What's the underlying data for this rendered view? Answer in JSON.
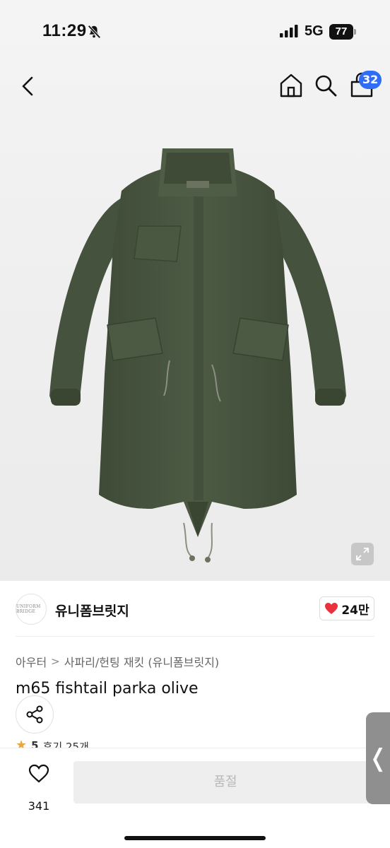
{
  "status_bar": {
    "time": "11:29",
    "network": "5G",
    "battery": "77"
  },
  "header": {
    "cart_count": "32"
  },
  "brand": {
    "name": "유니폼브릿지",
    "logo_text": "UNIFORM BRIDGE",
    "likes": "24만"
  },
  "breadcrumb": {
    "category": "아우터",
    "separator": ">",
    "subcategory": "사파리/헌팅 재킷 (유니폼브릿지)"
  },
  "product": {
    "title": "m65 fishtail parka olive",
    "rating_star": "★",
    "rating": "5",
    "reviews": "후기 25개"
  },
  "bottom_bar": {
    "wish_count": "341",
    "soldout_label": "품절"
  },
  "side_tab": {
    "label": "❬"
  },
  "icons": {
    "back": "chevron-left-icon",
    "home": "home-icon",
    "search": "search-icon",
    "bag": "shopping-bag-icon",
    "expand": "expand-icon",
    "heart_filled": "heart-filled-icon",
    "share": "share-icon",
    "heart_outline": "heart-outline-icon"
  },
  "colors": {
    "badge": "#2f6df6",
    "heart": "#e8313a",
    "parka": "#4a5741",
    "soldout_bg": "#eeeeee"
  }
}
